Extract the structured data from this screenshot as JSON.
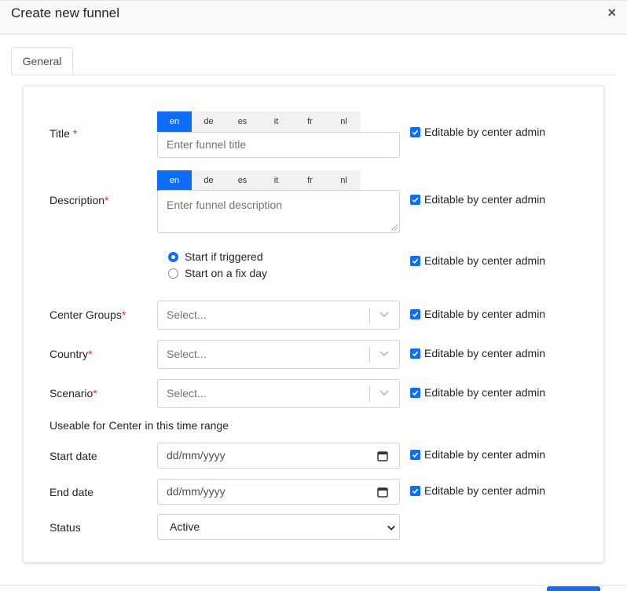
{
  "modal": {
    "title": "Create new funnel",
    "close_label": "×"
  },
  "tabs": [
    {
      "label": "General"
    }
  ],
  "languages": [
    "en",
    "de",
    "es",
    "it",
    "fr",
    "nl"
  ],
  "editable_label": "Editable by center admin",
  "fields": {
    "title": {
      "label": "Title",
      "required_mark": "*",
      "placeholder": "Enter funnel title"
    },
    "description": {
      "label": "Description",
      "required_mark": "*",
      "placeholder": "Enter funnel description"
    },
    "start_mode": {
      "options": [
        "Start if triggered",
        "Start on a fix day"
      ],
      "selected": "Start if triggered"
    },
    "center_groups": {
      "label": "Center Groups",
      "required_mark": "*",
      "placeholder": "Select..."
    },
    "country": {
      "label": "Country",
      "required_mark": "*",
      "placeholder": "Select..."
    },
    "scenario": {
      "label": "Scenario",
      "required_mark": "*",
      "placeholder": "Select..."
    },
    "time_range_heading": "Useable for Center in this time range",
    "start_date": {
      "label": "Start date",
      "placeholder": "dd/mm/yyyy"
    },
    "end_date": {
      "label": "End date",
      "placeholder": "dd/mm/yyyy"
    },
    "status": {
      "label": "Status",
      "value": "Active"
    }
  },
  "colors": {
    "accent": "#0d6efd",
    "required": "#dc3545"
  },
  "icons": {
    "checkbox": "checkmark-icon",
    "dropdown": "chevron-down-icon",
    "date": "calendar-icon"
  }
}
